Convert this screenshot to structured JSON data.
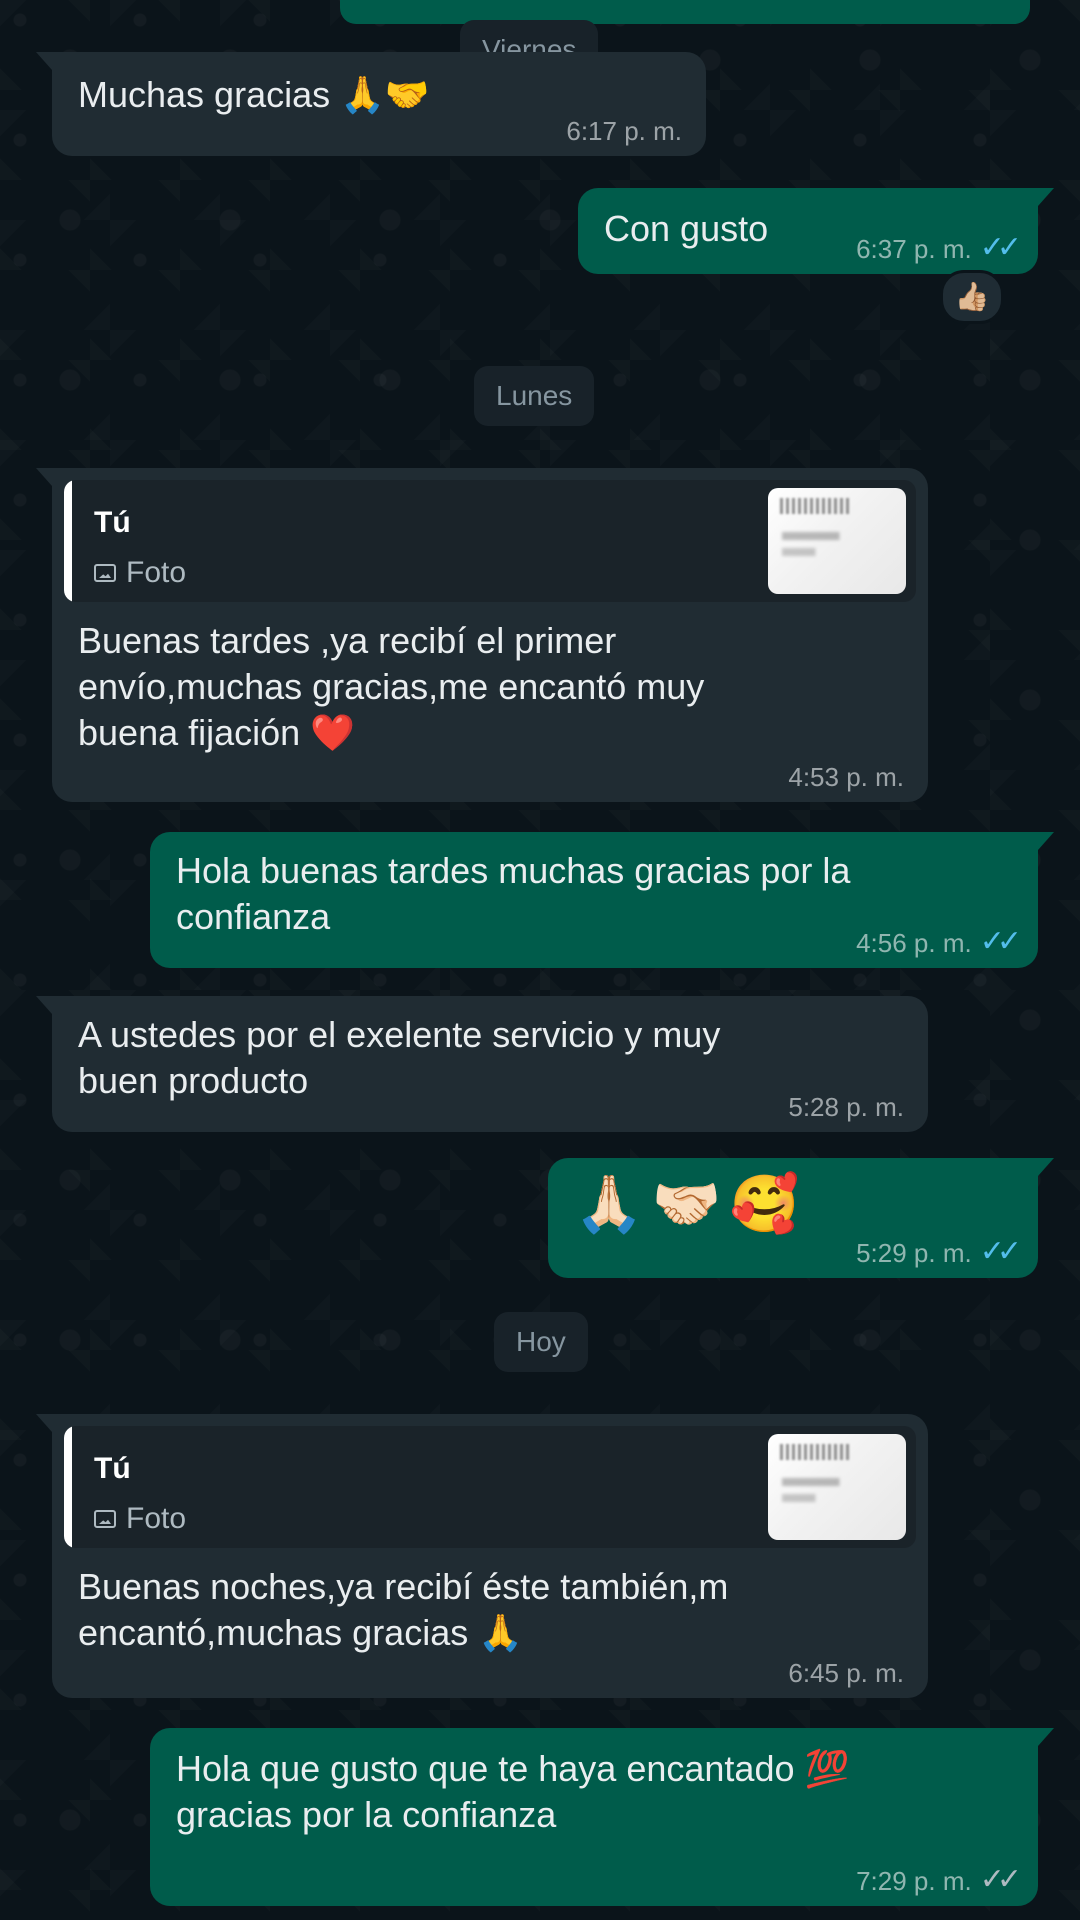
{
  "date_chips": {
    "viernes": "Viernes",
    "lunes": "Lunes",
    "hoy": "Hoy"
  },
  "messages": [
    {
      "text": "Muchas gracias 🙏🤝",
      "time": "6:17 p. m."
    },
    {
      "text": "Con gusto",
      "time": "6:37 p. m.",
      "ticks": "✓✓",
      "reaction": "👍🏼"
    },
    {
      "reply": {
        "sender": "Tú",
        "type": "Foto"
      },
      "text": "Buenas tardes ,ya recibí el primer\nenvío,muchas gracias,me encantó muy\nbuena fijación ❤️",
      "time": "4:53 p. m."
    },
    {
      "text": "Hola buenas tardes muchas gracias por la\nconfianza",
      "time": "4:56 p. m.",
      "ticks": "✓✓"
    },
    {
      "text": "A ustedes por el exelente servicio y muy\nbuen producto",
      "time": "5:28 p. m."
    },
    {
      "text": "🙏🏻🤝🏻🥰",
      "time": "5:29 p. m.",
      "ticks": "✓✓"
    },
    {
      "reply": {
        "sender": "Tú",
        "type": "Foto"
      },
      "text": "Buenas noches,ya recibí éste también,m\nencantó,muchas gracias 🙏",
      "time": "6:45 p. m."
    },
    {
      "text": "Hola que gusto que te haya encantado 💯\ngracias por la confianza",
      "time": "7:29 p. m.",
      "ticks": "✓✓"
    }
  ],
  "colors": {
    "background": "#0b141a",
    "incoming_bubble": "#202c33",
    "outgoing_bubble": "#005c4b",
    "date_chip": "#182229",
    "read_ticks": "#53bdeb",
    "sent_ticks": "#aebac1"
  }
}
